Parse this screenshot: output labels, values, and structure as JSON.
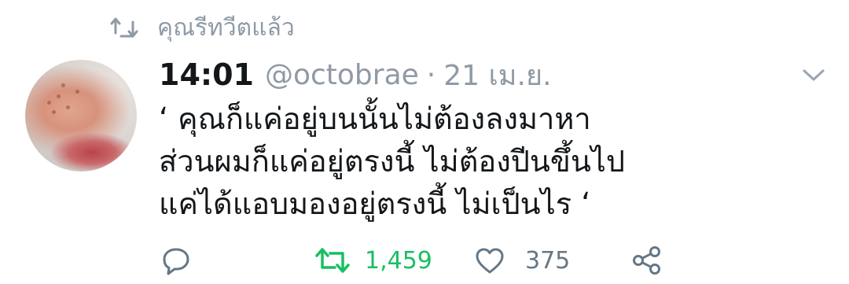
{
  "retweet_context": {
    "icon": "retweet-icon",
    "text": "คุณรีทวีตแล้ว"
  },
  "tweet": {
    "time": "14:01",
    "handle": "@octobrae",
    "separator": "·",
    "date": "21 เม.ย.",
    "lines": [
      "‘ คุณก็แค่อยู่บนนั้นไม่ต้องลงมาหา",
      "ส่วนผมก็แค่อยู่ตรงนี้ ไม่ต้องปีนขึ้นไป",
      "แค่ได้แอบมองอยู่ตรงนี้ ไม่เป็นไร ‘"
    ]
  },
  "actions": {
    "retweet_count": "1,459",
    "like_count": "375"
  },
  "colors": {
    "muted": "#8f9aa5",
    "text": "#14171a",
    "retweet_active": "#17bf63"
  }
}
